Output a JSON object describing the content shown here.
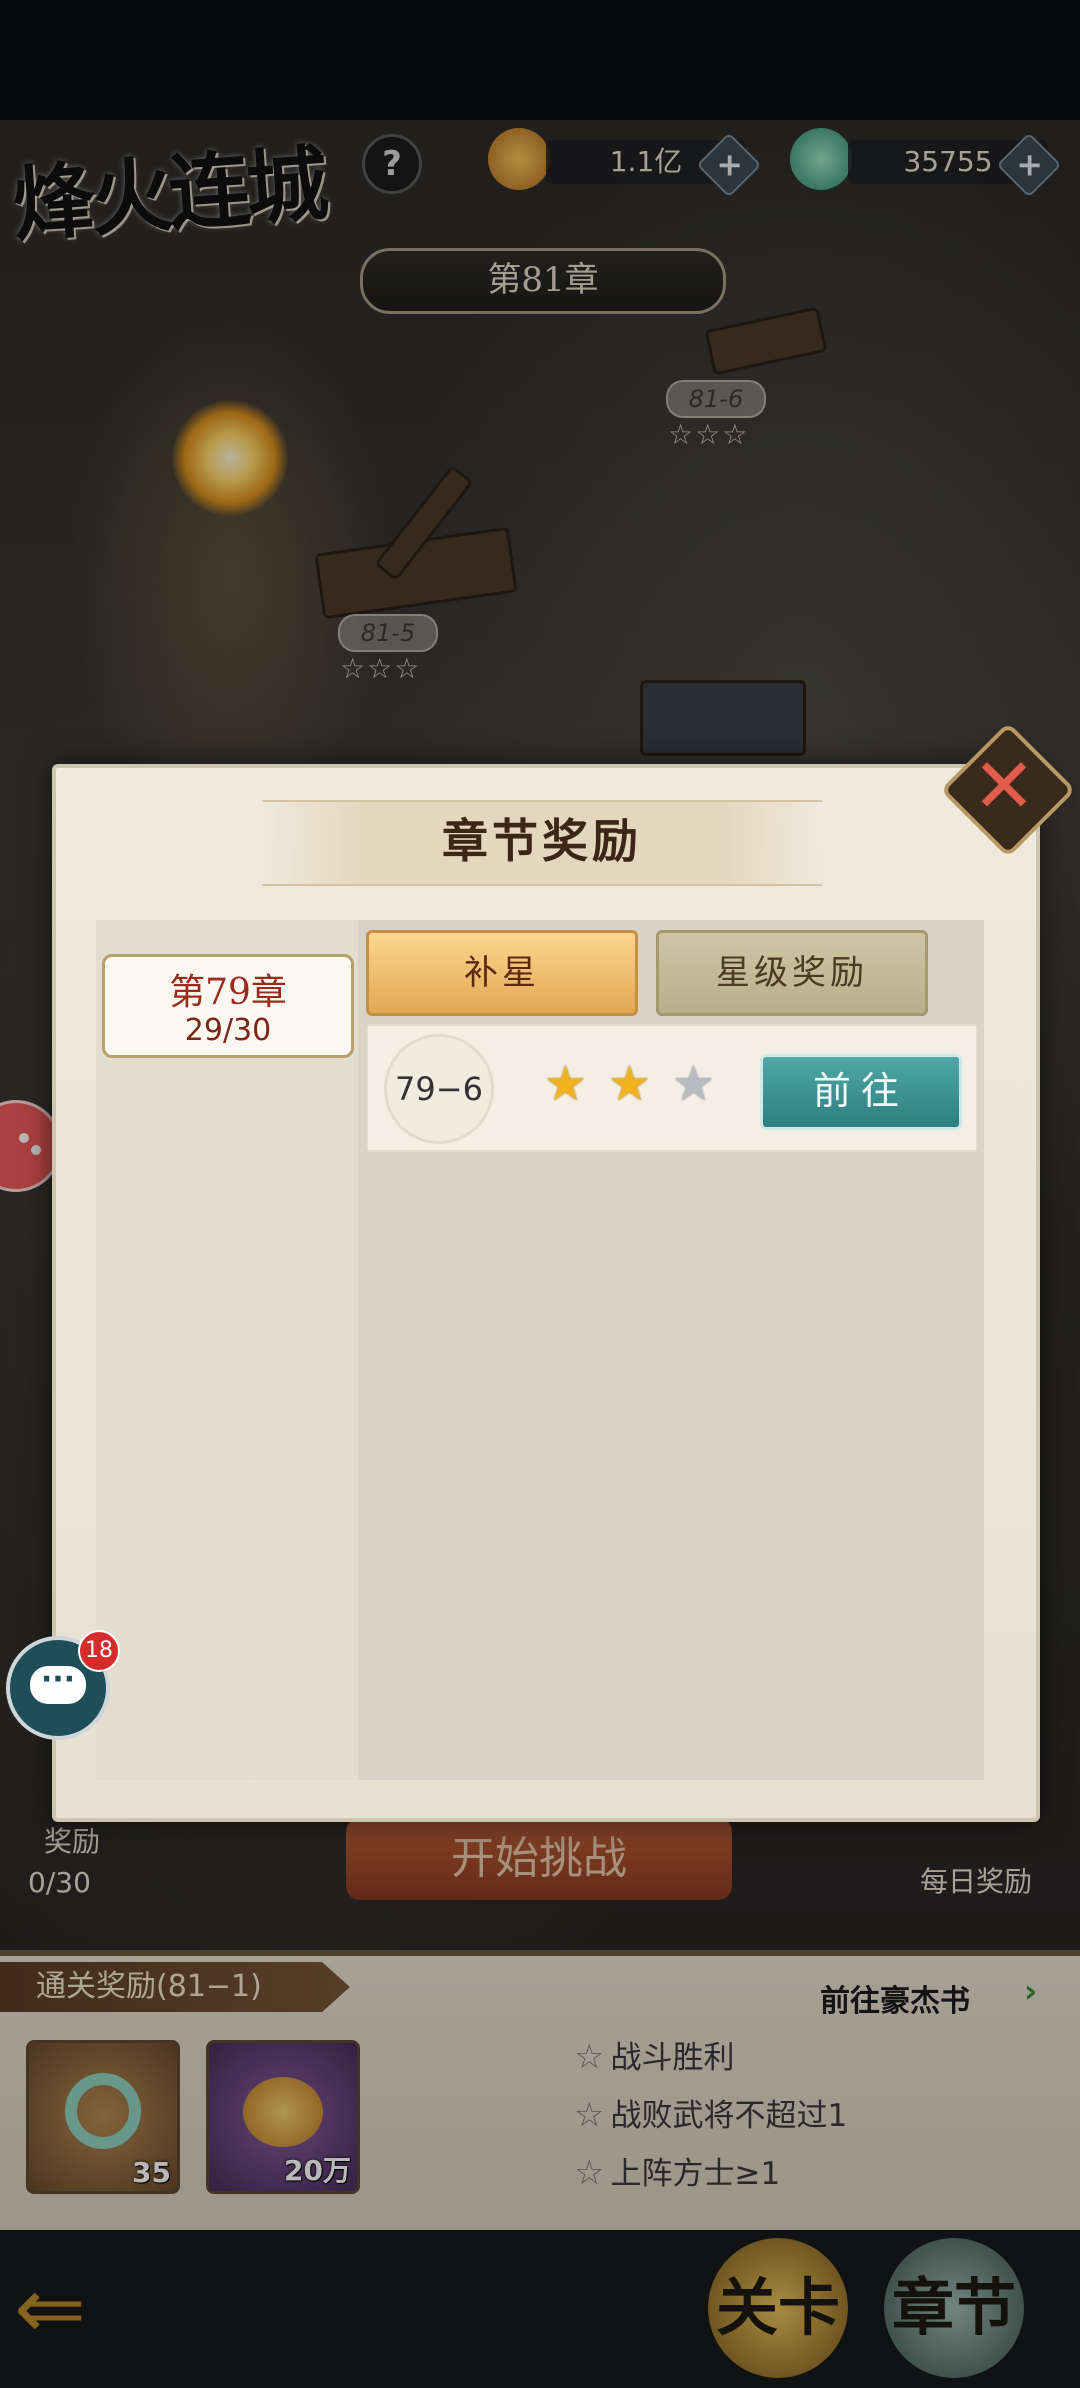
{
  "game": {
    "title": "烽火连城"
  },
  "currencies": [
    {
      "name": "copper-coins",
      "value": "1.1亿"
    },
    {
      "name": "jade",
      "value": "35755"
    }
  ],
  "map": {
    "chapter_banner": "第81章",
    "stages": [
      {
        "id": "81-6",
        "stars": 3
      },
      {
        "id": "81-5",
        "stars": 3
      }
    ]
  },
  "popup": {
    "title": "章节奖励",
    "chapters": [
      {
        "name": "第79章",
        "progress": "29/30"
      }
    ],
    "tabs": [
      {
        "label": "补星",
        "active": true
      },
      {
        "label": "星级奖励",
        "active": false
      }
    ],
    "rows": [
      {
        "stage": "79−6",
        "stars_earned": 2,
        "stars_total": 3,
        "button": "前往"
      }
    ]
  },
  "behind": {
    "start_button": "开始挑战",
    "star_reward_label": "奖励",
    "star_reward_progress": "0/30",
    "daily_reward": "每日奖励",
    "clear_reward_tab": "通关奖励(81−1)",
    "goto_hero_book": "前往豪杰书",
    "rewards": [
      {
        "item": "jade",
        "count": "35"
      },
      {
        "item": "copper-coins",
        "count": "20万"
      }
    ],
    "conditions": [
      "战斗胜利",
      "战败武将不超过1",
      "上阵方士≥1"
    ]
  },
  "chat": {
    "unread": "18"
  },
  "nav": {
    "stage": "关卡",
    "chapter": "章节"
  },
  "colors": {
    "accent_gold": "#e3a853",
    "goto_teal": "#2d7f7e",
    "star_gold": "#f0b21e",
    "badge_red": "#d52b2b"
  }
}
